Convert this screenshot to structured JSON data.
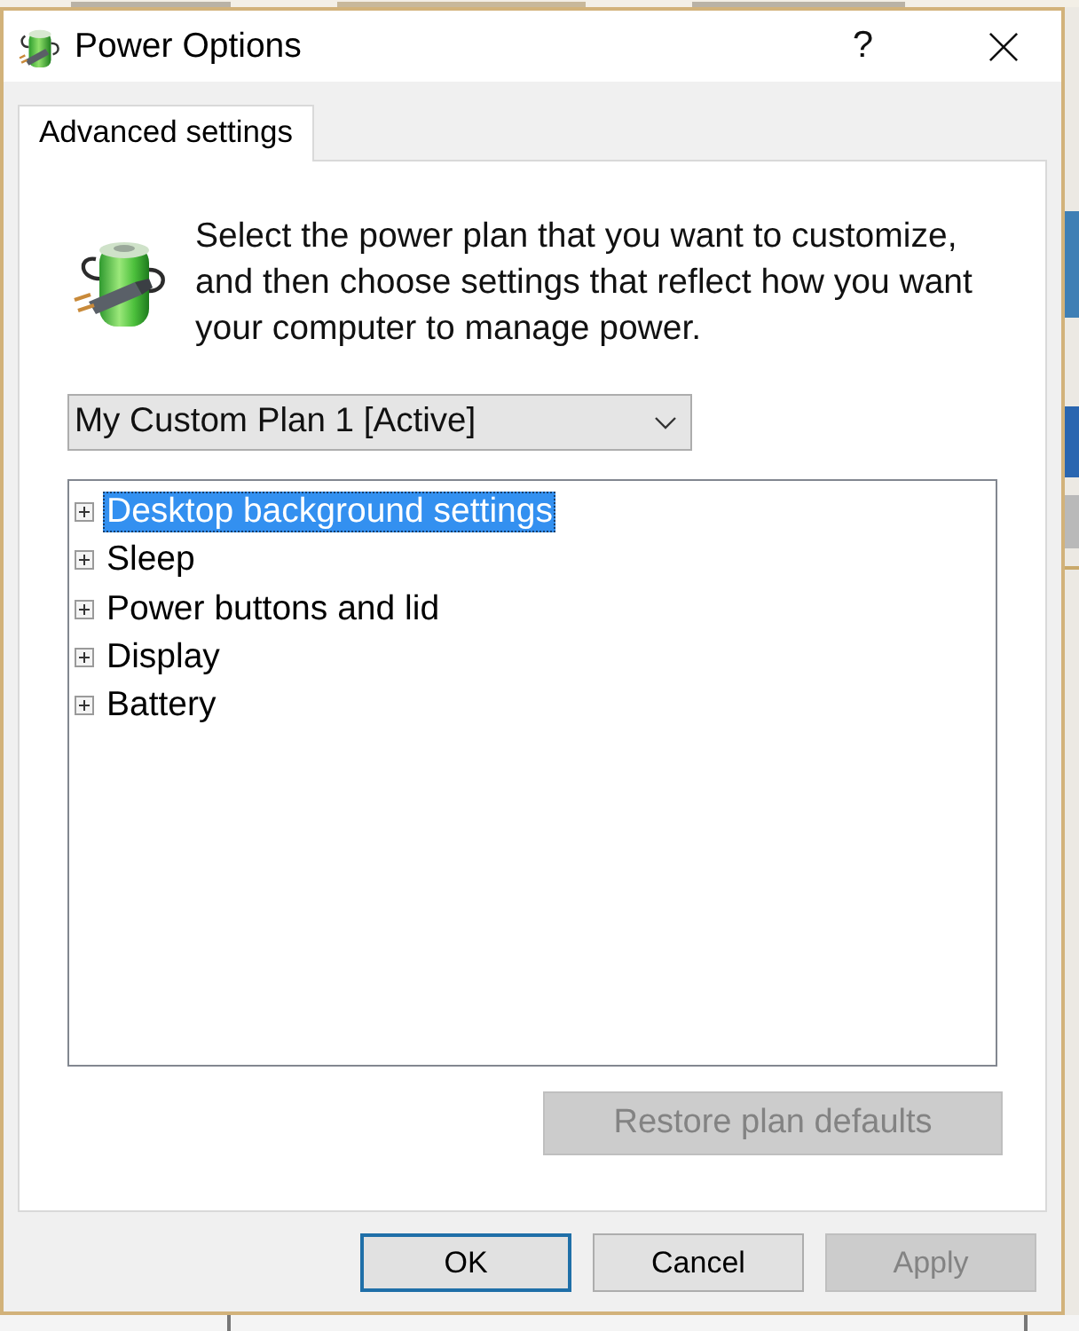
{
  "window": {
    "title": "Power Options",
    "help": "?"
  },
  "tabs": [
    {
      "label": "Advanced settings",
      "selected": true
    }
  ],
  "description": "Select the power plan that you want to customize, and then choose settings that reflect how you want your computer to manage power.",
  "plan_dropdown": {
    "value": "My Custom Plan 1 [Active]"
  },
  "settings_tree": [
    {
      "label": "Desktop background settings",
      "expanded": false,
      "selected": true
    },
    {
      "label": "Sleep",
      "expanded": false,
      "selected": false
    },
    {
      "label": "Power buttons and lid",
      "expanded": false,
      "selected": false
    },
    {
      "label": "Display",
      "expanded": false,
      "selected": false
    },
    {
      "label": "Battery",
      "expanded": false,
      "selected": false
    }
  ],
  "restore_button": {
    "label": "Restore plan defaults",
    "disabled": true
  },
  "buttons": [
    {
      "label": "OK",
      "default": true,
      "disabled": false
    },
    {
      "label": "Cancel",
      "default": false,
      "disabled": false
    },
    {
      "label": "Apply",
      "default": false,
      "disabled": true
    }
  ]
}
